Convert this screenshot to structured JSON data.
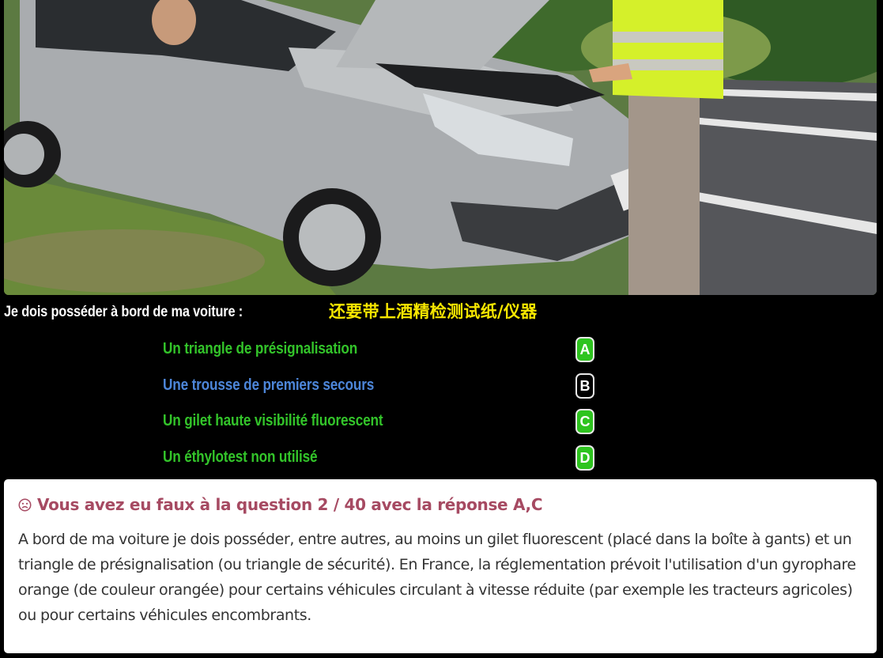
{
  "photo": {
    "alt": "Voiture en panne avec triangle et gilet"
  },
  "question": {
    "text": "Je dois posséder à bord de ma voiture :",
    "overlay_caption": "还要带上酒精检测试纸/仪器"
  },
  "answers": [
    {
      "text": "Un triangle de présignalisation",
      "letter": "A",
      "status": "correct"
    },
    {
      "text": "Une trousse de premiers secours",
      "letter": "B",
      "status": "wrong"
    },
    {
      "text": "Un gilet haute visibilité fluorescent",
      "letter": "C",
      "status": "correct"
    },
    {
      "text": "Un éthylotest non utilisé",
      "letter": "D",
      "status": "correct"
    }
  ],
  "result": {
    "icon": "sad-face-icon",
    "title": "Vous avez eu faux à la question 2 / 40 avec la réponse A,C",
    "explanation": "A bord de ma voiture je dois posséder, entre autres, au moins un gilet fluorescent (placé dans la boîte à gants) et un triangle de présignalisation (ou triangle de sécurité). En France, la réglementation prévoit l'utilisation d'un gyrophare orange (de couleur orangée) pour certains véhicules circulant à vitesse réduite (par exemple les tracteurs agricoles) ou pour certains véhicules encombrants."
  },
  "colors": {
    "correct_answer": "#33c42a",
    "wrong_answer": "#4d86d9",
    "overlay_caption": "#f6e600",
    "result_title": "#a64a62",
    "badge_green": "#2ec41f"
  }
}
